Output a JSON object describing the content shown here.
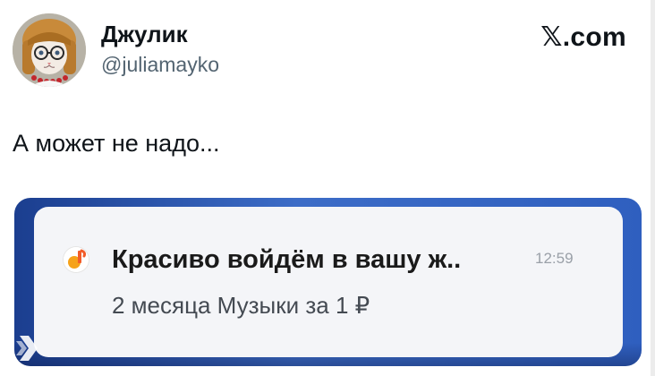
{
  "tweet": {
    "author": {
      "display_name": "Джулик",
      "handle": "@juliamayko"
    },
    "brand": "𝕏.com",
    "text": "А может не надо..."
  },
  "media": {
    "notification": {
      "app_icon": "music-note-icon",
      "title": "Красиво войдём в вашу ж..",
      "time": "12:59",
      "body": "2 месяца Музыки за 1 ₽"
    }
  },
  "colors": {
    "text_primary": "#0f1419",
    "text_secondary": "#536471",
    "media_blue": "#2f5fbf",
    "notif_bg": "#f4f5f8",
    "app_icon_orange": "#f6a21a"
  }
}
